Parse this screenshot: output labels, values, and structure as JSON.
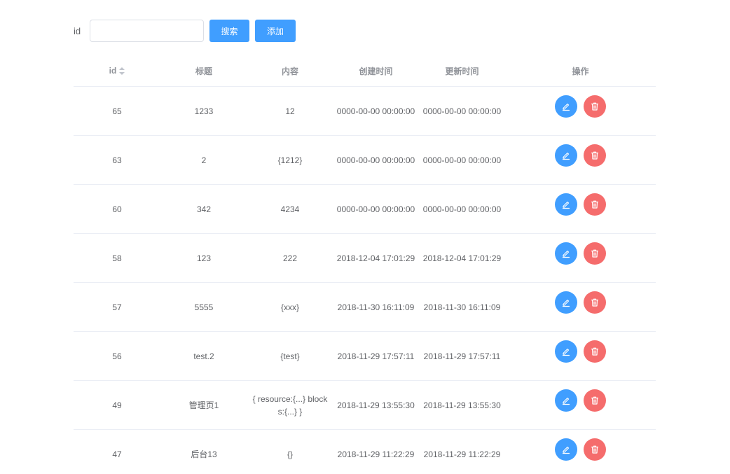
{
  "search": {
    "label": "id",
    "input_value": "",
    "search_button": "搜索",
    "add_button": "添加"
  },
  "table": {
    "columns": [
      "id",
      "标题",
      "内容",
      "创建时间",
      "更新时间",
      "操作"
    ],
    "rows": [
      {
        "id": "65",
        "title": "1233",
        "content": "12",
        "created": "0000-00-00 00:00:00",
        "updated": "0000-00-00 00:00:00"
      },
      {
        "id": "63",
        "title": "2",
        "content": "{1212}",
        "created": "0000-00-00 00:00:00",
        "updated": "0000-00-00 00:00:00"
      },
      {
        "id": "60",
        "title": "342",
        "content": "4234",
        "created": "0000-00-00 00:00:00",
        "updated": "0000-00-00 00:00:00"
      },
      {
        "id": "58",
        "title": "123",
        "content": "222",
        "created": "2018-12-04 17:01:29",
        "updated": "2018-12-04 17:01:29"
      },
      {
        "id": "57",
        "title": "5555",
        "content": "{xxx}",
        "created": "2018-11-30 16:11:09",
        "updated": "2018-11-30 16:11:09"
      },
      {
        "id": "56",
        "title": "test.2",
        "content": "{test}",
        "created": "2018-11-29 17:57:11",
        "updated": "2018-11-29 17:57:11"
      },
      {
        "id": "49",
        "title": "管理页1",
        "content": "{ resource:{...} blocks:{...} }",
        "created": "2018-11-29 13:55:30",
        "updated": "2018-11-29 13:55:30"
      },
      {
        "id": "47",
        "title": "后台13",
        "content": "{}",
        "created": "2018-11-29 11:22:29",
        "updated": "2018-11-29 11:22:29"
      }
    ]
  },
  "colors": {
    "primary": "#409eff",
    "danger": "#f56c6c",
    "border": "#ebeef5",
    "header_text": "#909399",
    "body_text": "#606266"
  },
  "icons": {
    "edit": "edit-icon",
    "delete": "trash-icon",
    "sort": "sort-caret-icon"
  }
}
